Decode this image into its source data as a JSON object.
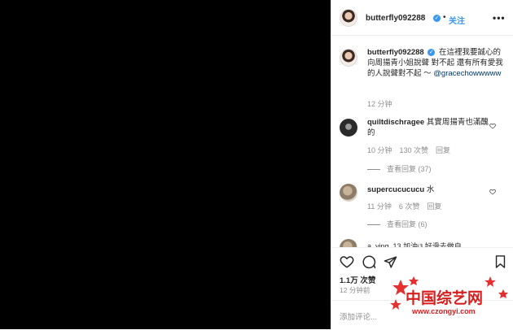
{
  "post": {
    "username": "butterfly092288",
    "verified_mark": "✓",
    "separator": "•",
    "follow_label": "关注",
    "more_glyph": "•••"
  },
  "caption": {
    "username": "butterfly092288",
    "text": "在這裡我要誠心的向周揚青小姐說聲 對不起 還有所有愛我的人說聲對不起 ～",
    "mention": "@gracechowwwww",
    "time": "12 分钟"
  },
  "comments": [
    {
      "username": "quiltdischragee",
      "text": "其實周揚青也滿醜的",
      "time": "10 分钟",
      "likes": "130 次赞",
      "reply_label": "回复",
      "view_replies": "查看回复 (37)"
    },
    {
      "username": "supercucucucu",
      "text": "水",
      "time": "11 分钟",
      "likes": "6 次赞",
      "reply_label": "回复",
      "view_replies": "查看回复 (6)"
    }
  ],
  "partial_comment": "a_ying_13 加油ଓ 好滑去做自",
  "footer": {
    "likes_count": "1.1万 次赞",
    "time_ago": "12 分钟前",
    "comment_placeholder": "添加评论..."
  },
  "icons": {
    "like": "heart-icon",
    "comment": "comment-bubble-icon",
    "share": "share-icon",
    "save": "bookmark-icon"
  },
  "watermark": {
    "title": "中国综艺网",
    "url": "www.czongyi.com"
  },
  "colors": {
    "link": "#3897f0",
    "muted": "#8e8e8e",
    "text": "#262626",
    "media_bg": "#000000",
    "watermark": "#d61f1f"
  }
}
